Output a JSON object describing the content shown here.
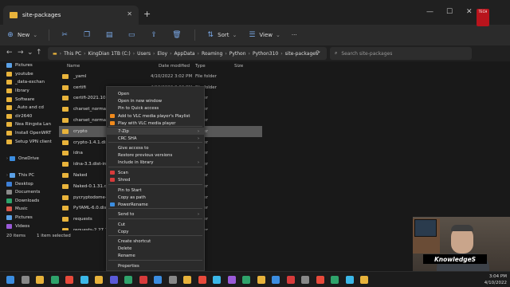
{
  "window": {
    "tab_title": "site-packages",
    "new_tab": "+",
    "close_tab": "✕",
    "minimize": "—",
    "maximize": "☐",
    "close": "✕"
  },
  "toolbar": {
    "new_label": "New",
    "sort_label": "Sort",
    "view_label": "View",
    "more": "···"
  },
  "address": {
    "crumbs": [
      "This PC",
      "KingDian 1TB (C:)",
      "Users",
      "Eloy",
      "AppData",
      "Roaming",
      "Python",
      "Python310",
      "site-packages"
    ],
    "search_placeholder": "Search site-packages"
  },
  "sidebar": {
    "items": [
      {
        "label": "Pictures",
        "color": "#5aa0e6"
      },
      {
        "label": "youtube",
        "color": "#e8b33b"
      },
      {
        "label": "_data-exchan",
        "color": "#e8b33b"
      },
      {
        "label": "library",
        "color": "#e8b33b"
      },
      {
        "label": "Software",
        "color": "#e8b33b"
      },
      {
        "label": "_Auto and cd",
        "color": "#e8b33b"
      },
      {
        "label": "dir2640",
        "color": "#e8b33b"
      },
      {
        "label": "Nea Ringsta Lan",
        "color": "#e8b33b"
      },
      {
        "label": "Install OpenWRT",
        "color": "#e8b33b"
      },
      {
        "label": "Setup VPN client",
        "color": "#e8b33b"
      },
      {
        "label": "",
        "color": "#191919"
      },
      {
        "label": "OneDrive",
        "color": "#3b8de0"
      },
      {
        "label": "",
        "color": "#191919"
      },
      {
        "label": "This PC",
        "color": "#5aa0e6"
      },
      {
        "label": "Desktop",
        "color": "#3d7fd6"
      },
      {
        "label": "Documents",
        "color": "#8a8a8a"
      },
      {
        "label": "Downloads",
        "color": "#2fa36b"
      },
      {
        "label": "Music",
        "color": "#d8584a"
      },
      {
        "label": "Pictures",
        "color": "#5aa0e6"
      },
      {
        "label": "Videos",
        "color": "#9a5ad8"
      },
      {
        "label": "KingDian 1TB (C",
        "color": "#888888"
      }
    ]
  },
  "columns": {
    "name": "Name",
    "date": "Date modified",
    "type": "Type",
    "size": "Size"
  },
  "files": [
    {
      "name": "_yaml",
      "date": "4/10/2022 3:02 PM",
      "type": "File folder"
    },
    {
      "name": "certifi",
      "date": "4/10/2022 3:02 PM",
      "type": "File folder"
    },
    {
      "name": "certifi-2021.10.8.dist-info",
      "date": "",
      "type": "folder"
    },
    {
      "name": "charset_normalizer",
      "date": "",
      "type": "folder"
    },
    {
      "name": "charset_normalizer-2.0",
      "date": "",
      "type": "folder"
    },
    {
      "name": "crypto",
      "date": "",
      "type": "folder"
    },
    {
      "name": "crypto-1.4.1.dist-info",
      "date": "",
      "type": "folder"
    },
    {
      "name": "idna",
      "date": "",
      "type": "folder"
    },
    {
      "name": "idna-3.3.dist-info",
      "date": "",
      "type": "folder"
    },
    {
      "name": "Naked",
      "date": "",
      "type": "folder"
    },
    {
      "name": "Naked-0.1.31.dist-info",
      "date": "",
      "type": "folder"
    },
    {
      "name": "pycryptodome-3.14.1",
      "date": "",
      "type": "folder"
    },
    {
      "name": "PyYAML-6.0.dist-info",
      "date": "",
      "type": "folder"
    },
    {
      "name": "requests",
      "date": "",
      "type": "folder"
    },
    {
      "name": "requests-2.27.1.dist-",
      "date": "",
      "type": "folder"
    }
  ],
  "status": {
    "count": "20 items",
    "selected": "1 item selected"
  },
  "context_menu": {
    "items": [
      {
        "label": "Open",
        "color": ""
      },
      {
        "label": "Open in new window",
        "color": ""
      },
      {
        "label": "Pin to Quick access",
        "color": ""
      },
      {
        "label": "Add to VLC media player's Playlist",
        "color": "#f08a1c"
      },
      {
        "label": "Play with VLC media player",
        "color": "#f08a1c"
      },
      {
        "label": "7-Zip",
        "color": "",
        "sub": "›"
      },
      {
        "label": "CRC SHA",
        "color": "",
        "sub": "›"
      },
      {
        "label": "Give access to",
        "color": "",
        "sub": "›"
      },
      {
        "label": "Restore previous versions",
        "color": ""
      },
      {
        "label": "Include in library",
        "color": "",
        "sub": "›"
      },
      {
        "label": "Scan",
        "color": "#d83b3b"
      },
      {
        "label": "Shred",
        "color": "#d83b3b"
      },
      {
        "label": "Pin to Start",
        "color": ""
      },
      {
        "label": "Copy as path",
        "color": ""
      },
      {
        "label": "PowerRename",
        "color": "#3b8de0"
      },
      {
        "label": "Send to",
        "color": "",
        "sub": "›"
      },
      {
        "label": "Cut",
        "color": ""
      },
      {
        "label": "Copy",
        "color": ""
      },
      {
        "label": "Create shortcut",
        "color": ""
      },
      {
        "label": "Delete",
        "color": ""
      },
      {
        "label": "Rename",
        "color": ""
      },
      {
        "label": "Properties",
        "color": ""
      }
    ]
  },
  "overlay": {
    "brand": "KnowledgeS",
    "logo": "TECH"
  },
  "taskbar": {
    "time": "3:04 PM",
    "date": "4/10/2022"
  }
}
